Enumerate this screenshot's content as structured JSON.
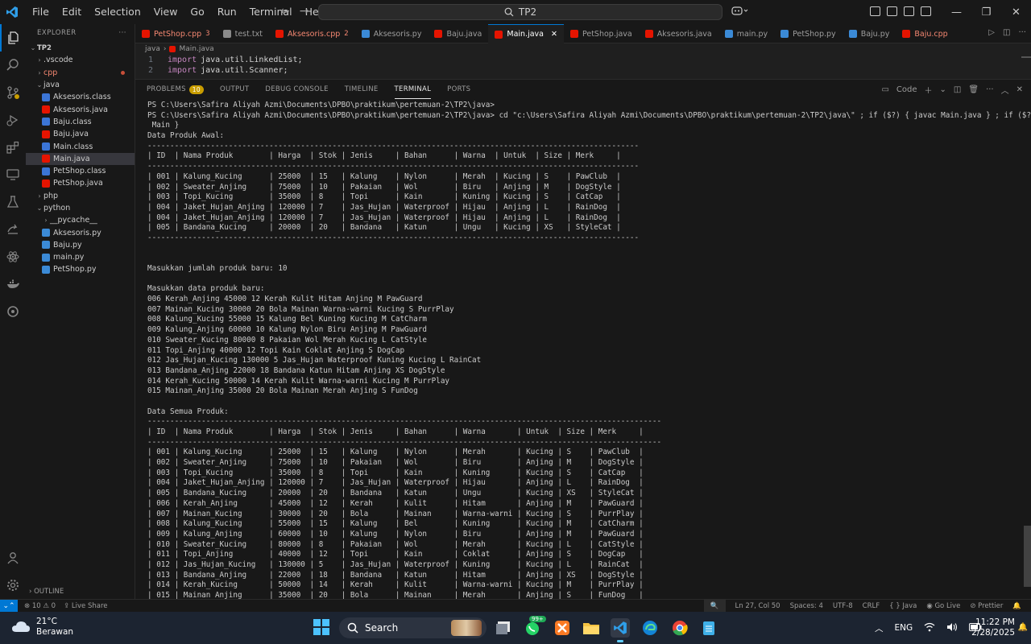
{
  "titlebar": {
    "menu": [
      "File",
      "Edit",
      "Selection",
      "View",
      "Go",
      "Run",
      "Terminal",
      "Help"
    ],
    "search_text": "TP2"
  },
  "sidebar": {
    "header": "EXPLORER",
    "items": [
      {
        "label": "TP2",
        "type": "root",
        "indent": 0
      },
      {
        "label": ".vscode",
        "type": "folder",
        "indent": 1
      },
      {
        "label": "cpp",
        "type": "folder",
        "indent": 1,
        "error": true
      },
      {
        "label": "java",
        "type": "folder-open",
        "indent": 1
      },
      {
        "label": "Aksesoris.class",
        "type": "class",
        "indent": 2
      },
      {
        "label": "Aksesoris.java",
        "type": "java",
        "indent": 2
      },
      {
        "label": "Baju.class",
        "type": "class",
        "indent": 2
      },
      {
        "label": "Baju.java",
        "type": "java",
        "indent": 2
      },
      {
        "label": "Main.class",
        "type": "class",
        "indent": 2
      },
      {
        "label": "Main.java",
        "type": "java",
        "indent": 2,
        "selected": true
      },
      {
        "label": "PetShop.class",
        "type": "class",
        "indent": 2
      },
      {
        "label": "PetShop.java",
        "type": "java",
        "indent": 2
      },
      {
        "label": "php",
        "type": "folder",
        "indent": 1
      },
      {
        "label": "python",
        "type": "folder-open",
        "indent": 1
      },
      {
        "label": "__pycache__",
        "type": "folder",
        "indent": 2
      },
      {
        "label": "Aksesoris.py",
        "type": "py",
        "indent": 2
      },
      {
        "label": "Baju.py",
        "type": "py",
        "indent": 2
      },
      {
        "label": "main.py",
        "type": "py",
        "indent": 2
      },
      {
        "label": "PetShop.py",
        "type": "py",
        "indent": 2
      }
    ],
    "outline": "OUTLINE"
  },
  "tabs": [
    {
      "label": "PetShop.cpp",
      "badge": "3",
      "type": "cpp",
      "error": true
    },
    {
      "label": "test.txt",
      "badge": "",
      "type": "txt",
      "error": false
    },
    {
      "label": "Aksesoris.cpp",
      "badge": "2",
      "type": "cpp",
      "error": true
    },
    {
      "label": "Aksesoris.py",
      "badge": "",
      "type": "py",
      "error": false
    },
    {
      "label": "Baju.java",
      "badge": "",
      "type": "java",
      "error": false
    },
    {
      "label": "Main.java",
      "badge": "",
      "type": "java",
      "error": false,
      "active": true
    },
    {
      "label": "PetShop.java",
      "badge": "",
      "type": "java",
      "error": false
    },
    {
      "label": "Aksesoris.java",
      "badge": "",
      "type": "java",
      "error": false
    },
    {
      "label": "main.py",
      "badge": "",
      "type": "py",
      "error": false
    },
    {
      "label": "PetShop.py",
      "badge": "",
      "type": "py",
      "error": false
    },
    {
      "label": "Baju.py",
      "badge": "",
      "type": "py",
      "error": false
    },
    {
      "label": "Baju.cpp",
      "badge": "",
      "type": "cpp",
      "error": true
    }
  ],
  "editor": {
    "breadcrumb": [
      "java",
      "Main.java"
    ],
    "lines": [
      {
        "num": "1",
        "kw": "import",
        "rest": "java.util.LinkedList;"
      },
      {
        "num": "2",
        "kw": "import",
        "rest": "java.util.Scanner;"
      }
    ]
  },
  "panel": {
    "tabs": [
      {
        "label": "PROBLEMS",
        "badge": "10"
      },
      {
        "label": "OUTPUT",
        "badge": ""
      },
      {
        "label": "DEBUG CONSOLE",
        "badge": ""
      },
      {
        "label": "TIMELINE",
        "badge": ""
      },
      {
        "label": "TERMINAL",
        "badge": "",
        "active": true
      },
      {
        "label": "PORTS",
        "badge": ""
      }
    ],
    "shell_label": "Code",
    "terminal_lines": [
      "PS C:\\Users\\Safira Aliyah Azmi\\Documents\\DPBO\\praktikum\\pertemuan-2\\TP2\\java>",
      "PS C:\\Users\\Safira Aliyah Azmi\\Documents\\DPBO\\praktikum\\pertemuan-2\\TP2\\java> cd \"c:\\Users\\Safira Aliyah Azmi\\Documents\\DPBO\\praktikum\\pertemuan-2\\TP2\\java\\\" ; if ($?) { javac Main.java } ; if ($?) { java",
      " Main }",
      "Data Produk Awal:",
      "-------------------------------------------------------------------------------------------------------------",
      "| ID  | Nama Produk        | Harga  | Stok | Jenis     | Bahan      | Warna  | Untuk  | Size | Merk     |",
      "-------------------------------------------------------------------------------------------------------------",
      "| 001 | Kalung_Kucing      | 25000  | 15   | Kalung    | Nylon      | Merah  | Kucing | S    | PawClub  |",
      "| 002 | Sweater_Anjing     | 75000  | 10   | Pakaian   | Wol        | Biru   | Anjing | M    | DogStyle |",
      "| 003 | Topi_Kucing        | 35000  | 8    | Topi      | Kain       | Kuning | Kucing | S    | CatCap   |",
      "| 004 | Jaket_Hujan_Anjing | 120000 | 7    | Jas_Hujan | Waterproof | Hijau  | Anjing | L    | RainDog  |",
      "| 004 | Jaket_Hujan_Anjing | 120000 | 7    | Jas_Hujan | Waterproof | Hijau  | Anjing | L    | RainDog  |",
      "| 005 | Bandana_Kucing     | 20000  | 20   | Bandana   | Katun      | Ungu   | Kucing | XS   | StyleCat |",
      "-------------------------------------------------------------------------------------------------------------",
      "",
      "",
      "Masukkan jumlah produk baru: 10",
      "",
      "Masukkan data produk baru:",
      "006 Kerah_Anjing 45000 12 Kerah Kulit Hitam Anjing M PawGuard",
      "007 Mainan_Kucing 30000 20 Bola Mainan Warna-warni Kucing S PurrPlay",
      "008 Kalung_Kucing 55000 15 Kalung Bel Kuning Kucing M CatCharm",
      "009 Kalung_Anjing 60000 10 Kalung Nylon Biru Anjing M PawGuard",
      "010 Sweater_Kucing 80000 8 Pakaian Wol Merah Kucing L CatStyle",
      "011 Topi_Anjing 40000 12 Topi Kain Coklat Anjing S DogCap",
      "012 Jas_Hujan_Kucing 130000 5 Jas_Hujan Waterproof Kuning Kucing L RainCat",
      "013 Bandana_Anjing 22000 18 Bandana Katun Hitam Anjing XS DogStyle",
      "014 Kerah_Kucing 50000 14 Kerah Kulit Warna-warni Kucing M PurrPlay",
      "015 Mainan_Anjing 35000 20 Bola Mainan Merah Anjing S FunDog",
      "",
      "Data Semua Produk:",
      "------------------------------------------------------------------------------------------------------------------",
      "| ID  | Nama Produk        | Harga  | Stok | Jenis     | Bahan      | Warna       | Untuk  | Size | Merk     |",
      "------------------------------------------------------------------------------------------------------------------",
      "| 001 | Kalung_Kucing      | 25000  | 15   | Kalung    | Nylon      | Merah       | Kucing | S    | PawClub  |",
      "| 002 | Sweater_Anjing     | 75000  | 10   | Pakaian   | Wol        | Biru        | Anjing | M    | DogStyle |",
      "| 003 | Topi_Kucing        | 35000  | 8    | Topi      | Kain       | Kuning      | Kucing | S    | CatCap   |",
      "| 004 | Jaket_Hujan_Anjing | 120000 | 7    | Jas_Hujan | Waterproof | Hijau       | Anjing | L    | RainDog  |",
      "| 005 | Bandana_Kucing     | 20000  | 20   | Bandana   | Katun      | Ungu        | Kucing | XS   | StyleCat |",
      "| 006 | Kerah_Anjing       | 45000  | 12   | Kerah     | Kulit      | Hitam       | Anjing | M    | PawGuard |",
      "| 007 | Mainan_Kucing      | 30000  | 20   | Bola      | Mainan     | Warna-warni | Kucing | S    | PurrPlay |",
      "| 008 | Kalung_Kucing      | 55000  | 15   | Kalung    | Bel        | Kuning      | Kucing | M    | CatCharm |",
      "| 009 | Kalung_Anjing      | 60000  | 10   | Kalung    | Nylon      | Biru        | Anjing | M    | PawGuard |",
      "| 010 | Sweater_Kucing     | 80000  | 8    | Pakaian   | Wol        | Merah       | Kucing | L    | CatStyle |",
      "| 011 | Topi_Anjing        | 40000  | 12   | Topi      | Kain       | Coklat      | Anjing | S    | DogCap   |",
      "| 012 | Jas_Hujan_Kucing   | 130000 | 5    | Jas_Hujan | Waterproof | Kuning      | Kucing | L    | RainCat  |",
      "| 013 | Bandana_Anjing     | 22000  | 18   | Bandana   | Katun      | Hitam       | Anjing | XS   | DogStyle |",
      "| 014 | Kerah_Kucing       | 50000  | 14   | Kerah     | Kulit      | Warna-warni | Kucing | M    | PurrPlay |",
      "| 015 | Mainan_Anjing      | 35000  | 20   | Bola      | Mainan     | Merah       | Anjing | S    | FunDog   |",
      "------------------------------------------------------------------------------------------------------------------"
    ]
  },
  "statusbar": {
    "problems": "⊗ 10 ⚠ 0",
    "live_share": "Live Share",
    "position": "Ln 27, Col 50",
    "spaces": "Spaces: 4",
    "encoding": "UTF-8",
    "eol": "CRLF",
    "language": "{ } Java",
    "go_live": "Go Live",
    "prettier": "Prettier"
  },
  "taskbar": {
    "temperature": "21°C",
    "weather": "Berawan",
    "search_label": "Search",
    "whatsapp_badge": "99+",
    "language": "ENG",
    "time": "11:22 PM",
    "date": "2/28/2025"
  },
  "colors": {
    "accent": "#0078d4",
    "error": "#f48771",
    "java_icon": "#e51400",
    "class_icon": "#3b75d6",
    "py_icon": "#3b8ad6"
  }
}
